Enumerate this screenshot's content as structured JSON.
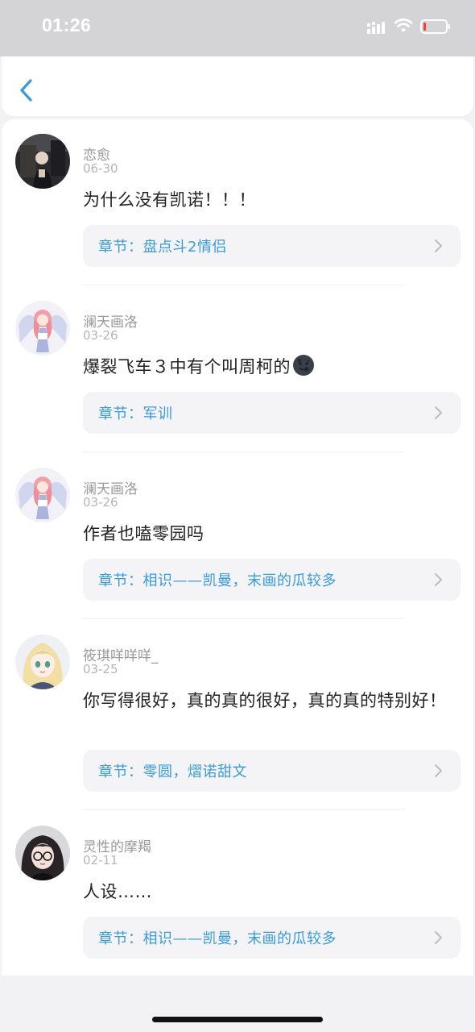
{
  "status_bar": {
    "time": "01:26"
  },
  "colors": {
    "accent": "#3a9bdc",
    "battery_low": "#ff3b30"
  },
  "comments": [
    {
      "username": "恋愈",
      "date": "06-30",
      "text": "为什么没有凯诺！！！",
      "chapter_prefix": "章节：",
      "chapter": "盘点斗2情侣",
      "avatar_icon": "avatar-dark-photo"
    },
    {
      "username": "澜天画洛",
      "date": "03-26",
      "text": "爆裂飞车３中有个叫周柯的",
      "emoji": "new-moon-face-emoji",
      "chapter_prefix": "章节：",
      "chapter": "军训",
      "avatar_icon": "avatar-anime-angel"
    },
    {
      "username": "澜天画洛",
      "date": "03-26",
      "text": "作者也嗑零园吗",
      "chapter_prefix": "章节：",
      "chapter": "相识——凯曼，末画的瓜较多",
      "avatar_icon": "avatar-anime-angel"
    },
    {
      "username": "筱琪咩咩咩_",
      "date": "03-25",
      "text": "你写得很好，真的真的很好，真的真的特别好！",
      "chapter_prefix": "章节：",
      "chapter": "零圆，熠诺甜文",
      "avatar_icon": "avatar-anime-blonde-girl"
    },
    {
      "username": "灵性的摩羯",
      "date": "02-11",
      "text": "人设……",
      "chapter_prefix": "章节：",
      "chapter": "相识——凯曼，末画的瓜较多",
      "avatar_icon": "avatar-glasses-girl"
    }
  ]
}
